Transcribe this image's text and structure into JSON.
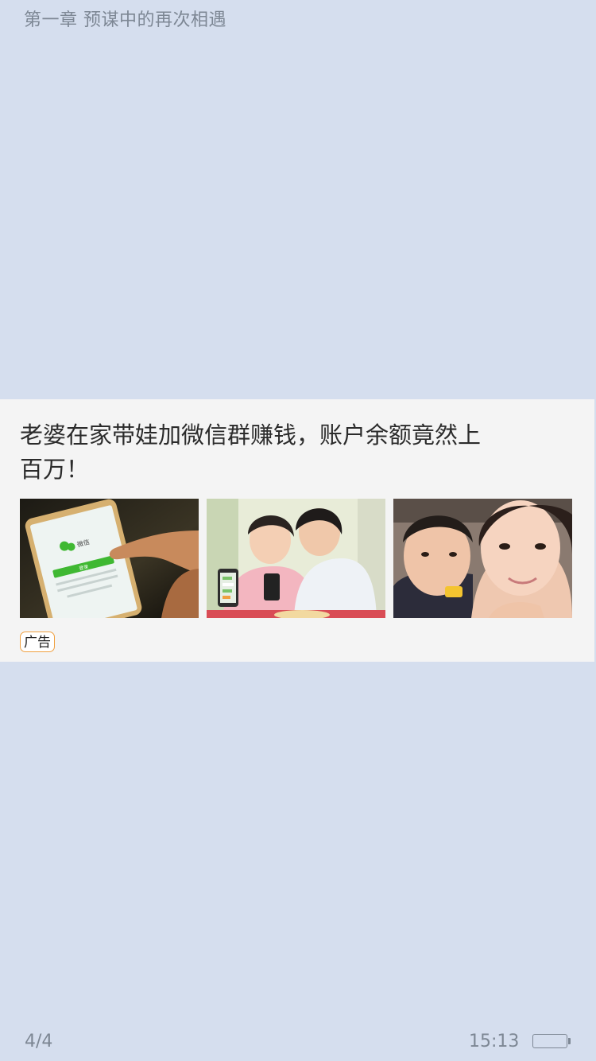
{
  "reader": {
    "chapter_title": "第一章 预谋中的再次相遇"
  },
  "ad": {
    "headline": "老婆在家带娃加微信群赚钱，账户余额竟然上百万！",
    "badge": "广告",
    "images": [
      {
        "name": "phone-wechat-login-image",
        "wechat_text": "微信",
        "login_button": "登录"
      },
      {
        "name": "couple-using-phone-image"
      },
      {
        "name": "mother-and-child-image"
      }
    ]
  },
  "footer": {
    "page_indicator": "4/4",
    "time": "15:13",
    "battery_level": 0.0
  },
  "colors": {
    "background": "#d5deee",
    "card": "#f4f4f4",
    "badge_border": "#f0a040",
    "muted_text": "#7d8794"
  }
}
